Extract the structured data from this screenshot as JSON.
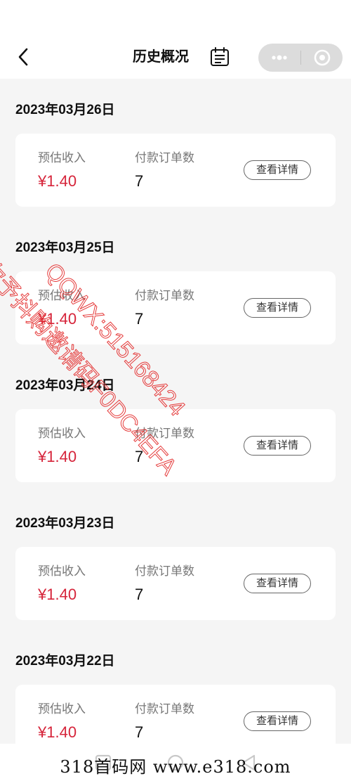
{
  "header": {
    "title": "历史概况",
    "back_icon": "chevron-left-icon",
    "calendar_icon": "calendar-icon",
    "more_icon": "more-dots-icon",
    "close_icon": "miniprogram-close-icon"
  },
  "labels": {
    "income": "预估收入",
    "orders": "付款订单数",
    "detail": "查看详情"
  },
  "days": [
    {
      "date": "2023年03月26日",
      "income": "¥1.40",
      "orders": "7"
    },
    {
      "date": "2023年03月25日",
      "income": "¥1.40",
      "orders": "7"
    },
    {
      "date": "2023年03月24日",
      "income": "¥1.40",
      "orders": "7"
    },
    {
      "date": "2023年03月23日",
      "income": "¥1.40",
      "orders": "7"
    },
    {
      "date": "2023年03月22日",
      "income": "¥1.40",
      "orders": "7"
    }
  ],
  "watermark": {
    "line1": "你予抖购邀请码F0DC4EFA",
    "line2": "QQWX:515168424"
  },
  "footer": {
    "brand": "318首码网  www.e318.com"
  },
  "colors": {
    "income": "#d6243a",
    "background": "#f5f5f5",
    "card": "#ffffff",
    "watermark": "#e22626"
  }
}
